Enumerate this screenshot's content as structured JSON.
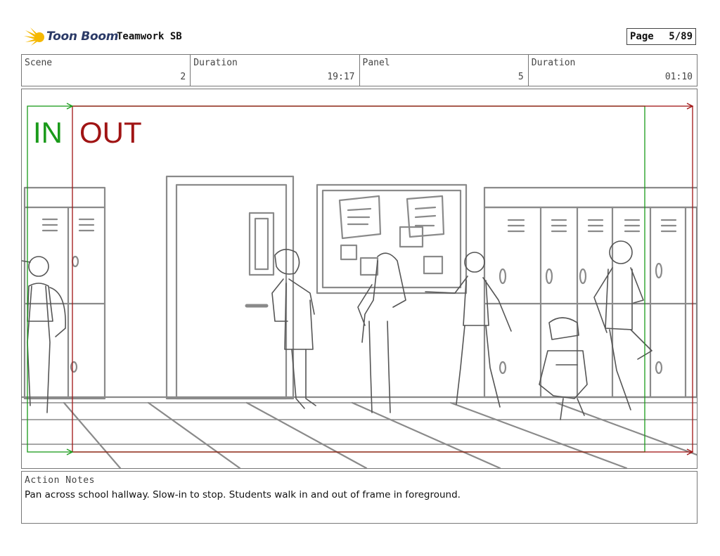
{
  "header": {
    "logo_text": "Toon Boom",
    "project_title": "Teamwork SB",
    "page_label": "Page",
    "page_value": "5/89"
  },
  "info": {
    "scene_label": "Scene",
    "scene_value": "2",
    "scene_duration_label": "Duration",
    "scene_duration_value": "19:17",
    "panel_label": "Panel",
    "panel_value": "5",
    "panel_duration_label": "Duration",
    "panel_duration_value": "01:10"
  },
  "panel": {
    "in_label": "IN",
    "out_label": "OUT",
    "in_color": "#1a9a1a",
    "out_color": "#a01414",
    "sketch_color": "#8a8a8a"
  },
  "notes": {
    "label": "Action Notes",
    "text": "Pan across school hallway. Slow-in to stop. Students walk in and out of frame in foreground."
  }
}
